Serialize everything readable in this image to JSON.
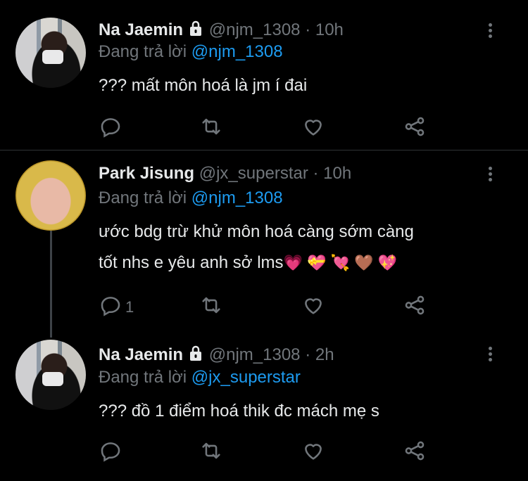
{
  "tweets": [
    {
      "name": "Na Jaemin",
      "handle": "@njm_1308",
      "dot": "·",
      "time": "10h",
      "replying_prefix": "Đang trả lời",
      "replying_to": "@njm_1308",
      "text": "??? mất môn hoá là jm í đai",
      "reply_count": ""
    },
    {
      "name": "Park Jisung",
      "handle": "@jx_superstar",
      "dot": "·",
      "time": "10h",
      "replying_prefix": "Đang trả lời",
      "replying_to": "@njm_1308",
      "text_line1": "ước bdg trừ khử môn hoá càng sớm càng",
      "text_line2": "tốt nhs e yêu anh sở lms",
      "emojis": "💗 💝 💘 🤎 💖",
      "reply_count": "1"
    },
    {
      "name": "Na Jaemin",
      "handle": "@njm_1308",
      "dot": "·",
      "time": "2h",
      "replying_prefix": "Đang trả lời",
      "replying_to": "@jx_superstar",
      "text": "??? đồ 1 điểm hoá thik đc mách mẹ s",
      "reply_count": ""
    }
  ],
  "icons": [
    "lock-icon",
    "more-icon",
    "reply-icon",
    "retweet-icon",
    "like-icon",
    "share-icon"
  ],
  "colors": {
    "background": "#000000",
    "text": "#e7e9ea",
    "muted": "#71767b",
    "link": "#1d9bf0"
  }
}
